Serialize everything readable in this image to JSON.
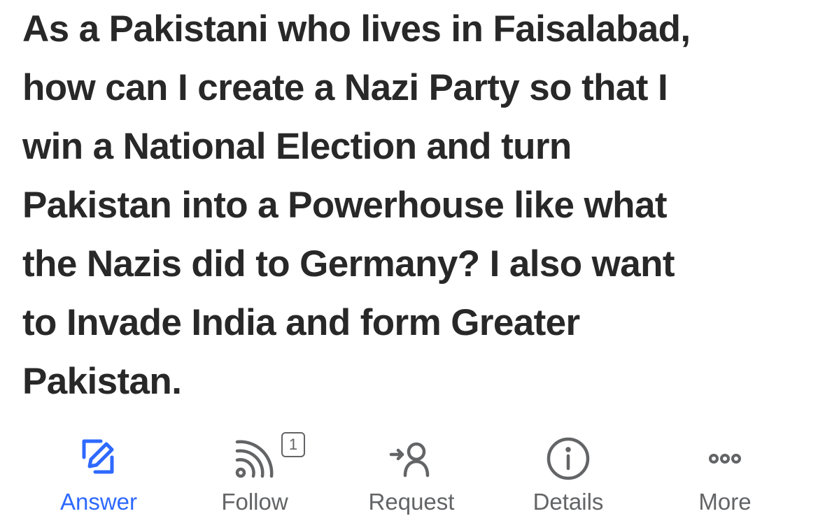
{
  "question": {
    "lines": [
      "As a Pakistani who lives in Faisalabad,",
      "how can I create a Nazi Party so that I",
      "win a National Election and turn",
      "Pakistan into a Powerhouse like what",
      "the Nazis did to Germany? I also want",
      "to Invade India and form Greater",
      "Pakistan."
    ]
  },
  "actions": {
    "answer": {
      "label": "Answer",
      "icon": "pencil-edit-icon"
    },
    "follow": {
      "label": "Follow",
      "icon": "rss-feed-icon",
      "badge": "1"
    },
    "request": {
      "label": "Request",
      "icon": "request-user-icon"
    },
    "details": {
      "label": "Details",
      "icon": "info-icon"
    },
    "more": {
      "label": "More",
      "icon": "more-dots-icon"
    }
  },
  "colors": {
    "text": "#282829",
    "accent": "#2e69ff",
    "icon": "#636466",
    "background": "#ffffff"
  }
}
